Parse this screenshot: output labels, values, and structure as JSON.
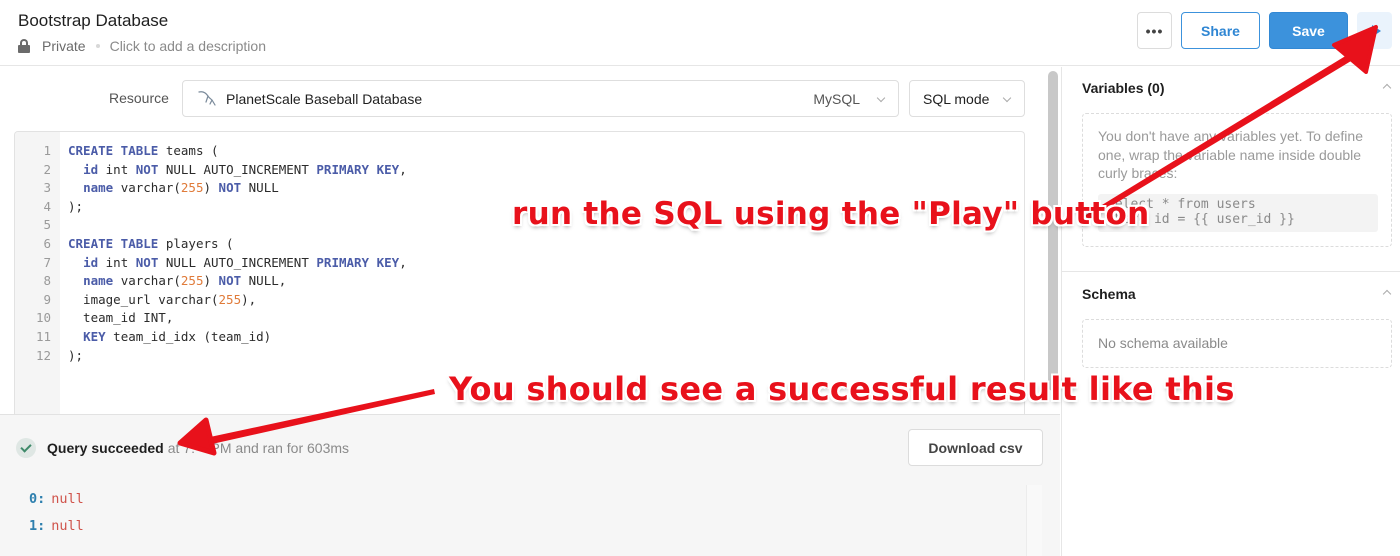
{
  "header": {
    "title": "Bootstrap Database",
    "visibility": "Private",
    "description_placeholder": "Click to add a description",
    "more_label": "•••",
    "share_label": "Share",
    "save_label": "Save",
    "play_icon": "play-icon"
  },
  "query": {
    "resource_label": "Resource",
    "resource_name": "PlanetScale Baseball Database",
    "resource_type": "MySQL",
    "resource_icon": "mysql-dolphin-icon",
    "mode": "SQL mode",
    "code_lines": [
      [
        {
          "t": "CREATE TABLE",
          "c": "kw"
        },
        {
          "t": " teams (",
          "c": ""
        }
      ],
      [
        {
          "t": "  ",
          "c": ""
        },
        {
          "t": "id",
          "c": "kw"
        },
        {
          "t": " int ",
          "c": ""
        },
        {
          "t": "NOT",
          "c": "kw"
        },
        {
          "t": " NULL AUTO_INCREMENT ",
          "c": ""
        },
        {
          "t": "PRIMARY KEY",
          "c": "kw"
        },
        {
          "t": ",",
          "c": ""
        }
      ],
      [
        {
          "t": "  ",
          "c": ""
        },
        {
          "t": "name",
          "c": "kw"
        },
        {
          "t": " varchar(",
          "c": ""
        },
        {
          "t": "255",
          "c": "num"
        },
        {
          "t": ") ",
          "c": ""
        },
        {
          "t": "NOT",
          "c": "kw"
        },
        {
          "t": " NULL",
          "c": ""
        }
      ],
      [
        {
          "t": ");",
          "c": ""
        }
      ],
      [
        {
          "t": "",
          "c": ""
        }
      ],
      [
        {
          "t": "CREATE TABLE",
          "c": "kw"
        },
        {
          "t": " players (",
          "c": ""
        }
      ],
      [
        {
          "t": "  ",
          "c": ""
        },
        {
          "t": "id",
          "c": "kw"
        },
        {
          "t": " int ",
          "c": ""
        },
        {
          "t": "NOT",
          "c": "kw"
        },
        {
          "t": " NULL AUTO_INCREMENT ",
          "c": ""
        },
        {
          "t": "PRIMARY KEY",
          "c": "kw"
        },
        {
          "t": ",",
          "c": ""
        }
      ],
      [
        {
          "t": "  ",
          "c": ""
        },
        {
          "t": "name",
          "c": "kw"
        },
        {
          "t": " varchar(",
          "c": ""
        },
        {
          "t": "255",
          "c": "num"
        },
        {
          "t": ") ",
          "c": ""
        },
        {
          "t": "NOT",
          "c": "kw"
        },
        {
          "t": " NULL,",
          "c": ""
        }
      ],
      [
        {
          "t": "  image_url varchar(",
          "c": ""
        },
        {
          "t": "255",
          "c": "num"
        },
        {
          "t": "),",
          "c": ""
        }
      ],
      [
        {
          "t": "  team_id INT,",
          "c": ""
        }
      ],
      [
        {
          "t": "  ",
          "c": ""
        },
        {
          "t": "KEY",
          "c": "kw"
        },
        {
          "t": " team_id_idx (team_id)",
          "c": ""
        }
      ],
      [
        {
          "t": ");",
          "c": ""
        }
      ]
    ]
  },
  "results": {
    "status_bold": "Query succeeded",
    "status_rest": "at 7:    PM and ran for 603ms",
    "download_label": "Download csv",
    "rows": [
      {
        "key": "0:",
        "value": "null"
      },
      {
        "key": "1:",
        "value": "null"
      }
    ]
  },
  "sidebar": {
    "variables_title": "Variables (0)",
    "variables_help": "You don't have any variables yet. To define one, wrap the variable name inside double curly braces:",
    "variables_example": "select * from users\nwhere id = {{ user_id }}",
    "schema_title": "Schema",
    "schema_empty": "No schema available"
  },
  "annotations": {
    "play_hint": "run the SQL using the \"Play\" button",
    "result_hint": "You should see a successful result like this",
    "color": "#e8111b"
  },
  "colors": {
    "primary": "#3c92dc",
    "keyword": "#4b5ca8",
    "number": "#e07b3a",
    "result_key": "#2d7fae",
    "result_null": "#d0534b"
  }
}
